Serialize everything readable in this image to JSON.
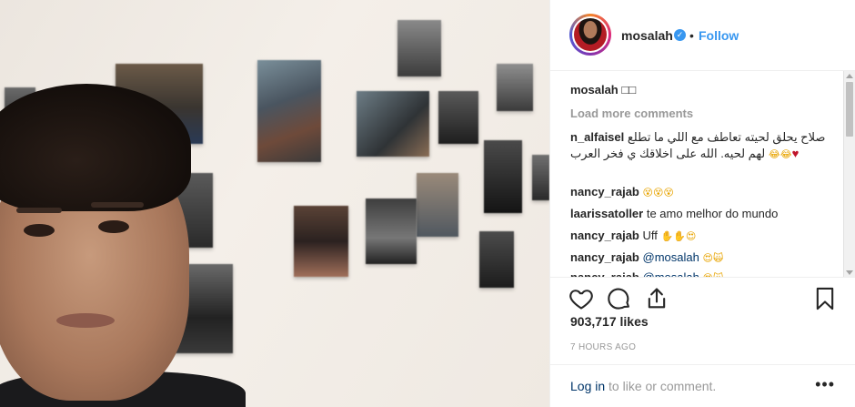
{
  "header": {
    "username": "mosalah",
    "verified_icon": "verified-badge-icon",
    "separator": "•",
    "follow_label": "Follow"
  },
  "caption": {
    "username": "mosalah",
    "text": "□□"
  },
  "load_more_label": "Load more comments",
  "comments": [
    {
      "user": "n_alfaisel",
      "text": "صلاح يحلق لحيته تعاطف مع اللي ما تطلع لهم لحيه. الله على اخلاقك ي فخر العرب",
      "emoji": "😂😂",
      "heart": "♥"
    },
    {
      "user": "nancy_rajab",
      "text": "",
      "emoji": "😵😵😵"
    },
    {
      "user": "laarissatoller",
      "text": "te amo melhor do mundo",
      "emoji": ""
    },
    {
      "user": "nancy_rajab",
      "text": "Uff",
      "emoji": "✋✋😍"
    },
    {
      "user": "nancy_rajab",
      "text": "@mosalah",
      "emoji": "😍🙀"
    },
    {
      "user": "nancy_rajab",
      "text": "@mosalah",
      "emoji": "😍🙀"
    }
  ],
  "actions": {
    "like_icon": "heart-outline-icon",
    "comment_icon": "comment-bubble-icon",
    "share_icon": "share-upload-icon",
    "save_icon": "bookmark-icon"
  },
  "likes_count": "903,717",
  "likes_label": "likes",
  "timestamp": "7 HOURS AGO",
  "footer": {
    "login_link": "Log in",
    "login_rest": " to like or comment.",
    "more_label": "•••"
  },
  "colors": {
    "link_blue": "#3897f0",
    "text_dark": "#262626",
    "muted_gray": "#999999",
    "login_blue": "#003569"
  }
}
